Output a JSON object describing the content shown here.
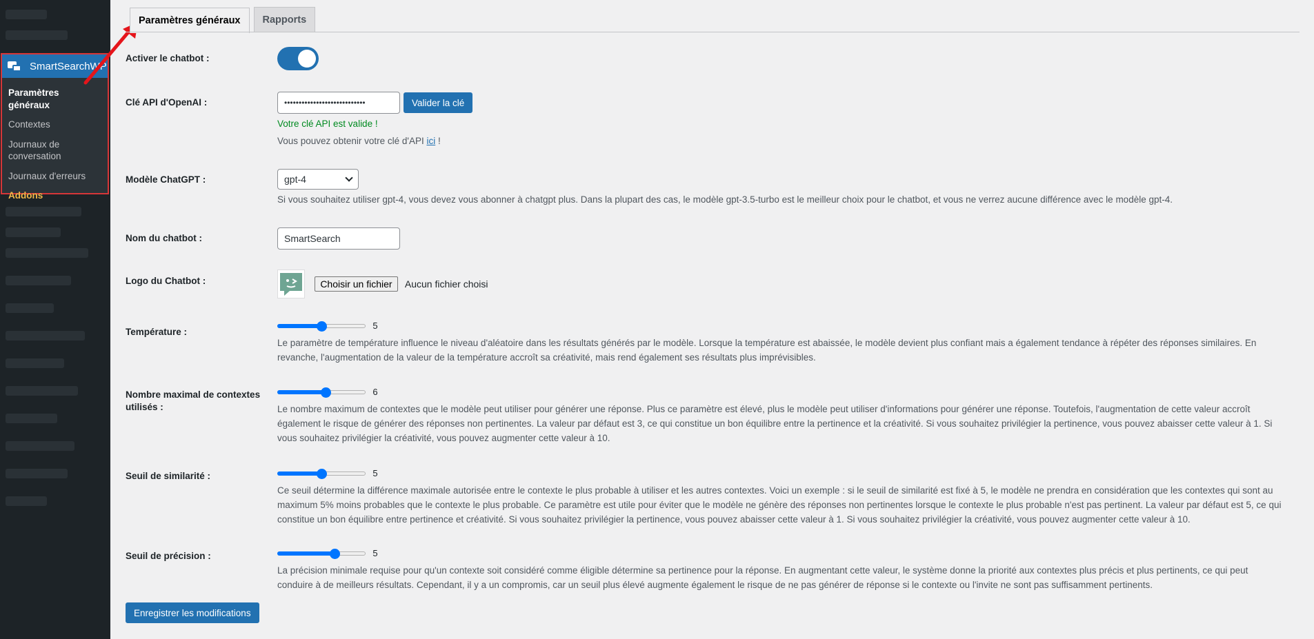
{
  "sidebar": {
    "plugin_name": "SmartSearchWP",
    "items": [
      {
        "label": "Paramètres généraux"
      },
      {
        "label": "Contextes"
      },
      {
        "label": "Journaux de conversation"
      },
      {
        "label": "Journaux d'erreurs"
      },
      {
        "label": "Addons"
      }
    ]
  },
  "tabs": [
    {
      "label": "Paramètres généraux",
      "active": true
    },
    {
      "label": "Rapports",
      "active": false
    }
  ],
  "settings": {
    "activate": {
      "label": "Activer le chatbot :",
      "on": true
    },
    "api_key": {
      "label": "Clé API d'OpenAI :",
      "value": "••••••••••••••••••••••••••••",
      "validate_label": "Valider la clé",
      "valid_msg": "Votre clé API est valide !",
      "info_prefix": "Vous pouvez obtenir votre clé d'API ",
      "info_link": "ici",
      "info_suffix": " !"
    },
    "model": {
      "label": "Modèle ChatGPT :",
      "value": "gpt-4",
      "desc": "Si vous souhaitez utiliser gpt-4, vous devez vous abonner à chatgpt plus. Dans la plupart des cas, le modèle gpt-3.5-turbo est le meilleur choix pour le chatbot, et vous ne verrez aucune différence avec le modèle gpt-4."
    },
    "name": {
      "label": "Nom du chatbot :",
      "value": "SmartSearch"
    },
    "logo": {
      "label": "Logo du Chatbot :",
      "file_button": "Choisir un fichier",
      "file_status": "Aucun fichier choisi"
    },
    "temperature": {
      "label": "Température :",
      "value": "5",
      "level": 0.5,
      "desc": "Le paramètre de température influence le niveau d'aléatoire dans les résultats générés par le modèle. Lorsque la température est abaissée, le modèle devient plus confiant mais a également tendance à répéter des réponses similaires. En revanche, l'augmentation de la valeur de la température accroît sa créativité, mais rend également ses résultats plus imprévisibles."
    },
    "max_contexts": {
      "label": "Nombre maximal de contextes utilisés :",
      "value": "6",
      "level": 0.55,
      "desc": "Le nombre maximum de contextes que le modèle peut utiliser pour générer une réponse. Plus ce paramètre est élevé, plus le modèle peut utiliser d'informations pour générer une réponse. Toutefois, l'augmentation de cette valeur accroît également le risque de générer des réponses non pertinentes. La valeur par défaut est 3, ce qui constitue un bon équilibre entre la pertinence et la créativité. Si vous souhaitez privilégier la pertinence, vous pouvez abaisser cette valeur à 1. Si vous souhaitez privilégier la créativité, vous pouvez augmenter cette valeur à 10."
    },
    "similarity": {
      "label": "Seuil de similarité :",
      "value": "5",
      "level": 0.5,
      "desc": "Ce seuil détermine la différence maximale autorisée entre le contexte le plus probable à utiliser et les autres contextes. Voici un exemple : si le seuil de similarité est fixé à 5, le modèle ne prendra en considération que les contextes qui sont au maximum 5% moins probables que le contexte le plus probable. Ce paramètre est utile pour éviter que le modèle ne génère des réponses non pertinentes lorsque le contexte le plus probable n'est pas pertinent. La valeur par défaut est 5, ce qui constitue un bon équilibre entre pertinence et créativité. Si vous souhaitez privilégier la pertinence, vous pouvez abaisser cette valeur à 1. Si vous souhaitez privilégier la créativité, vous pouvez augmenter cette valeur à 10."
    },
    "precision": {
      "label": "Seuil de précision :",
      "value": "5",
      "level": 0.65,
      "desc": "La précision minimale requise pour qu'un contexte soit considéré comme éligible détermine sa pertinence pour la réponse. En augmentant cette valeur, le système donne la priorité aux contextes plus précis et plus pertinents, ce qui peut conduire à de meilleurs résultats. Cependant, il y a un compromis, car un seuil plus élevé augmente également le risque de ne pas générer de réponse si le contexte ou l'invite ne sont pas suffisamment pertinents."
    }
  },
  "save_label": "Enregistrer les modifications",
  "colors": {
    "accent": "#2271b1",
    "sidebar": "#1d2327",
    "highlight": "#d63638",
    "valid": "#008a20",
    "addons": "#f0b849"
  }
}
